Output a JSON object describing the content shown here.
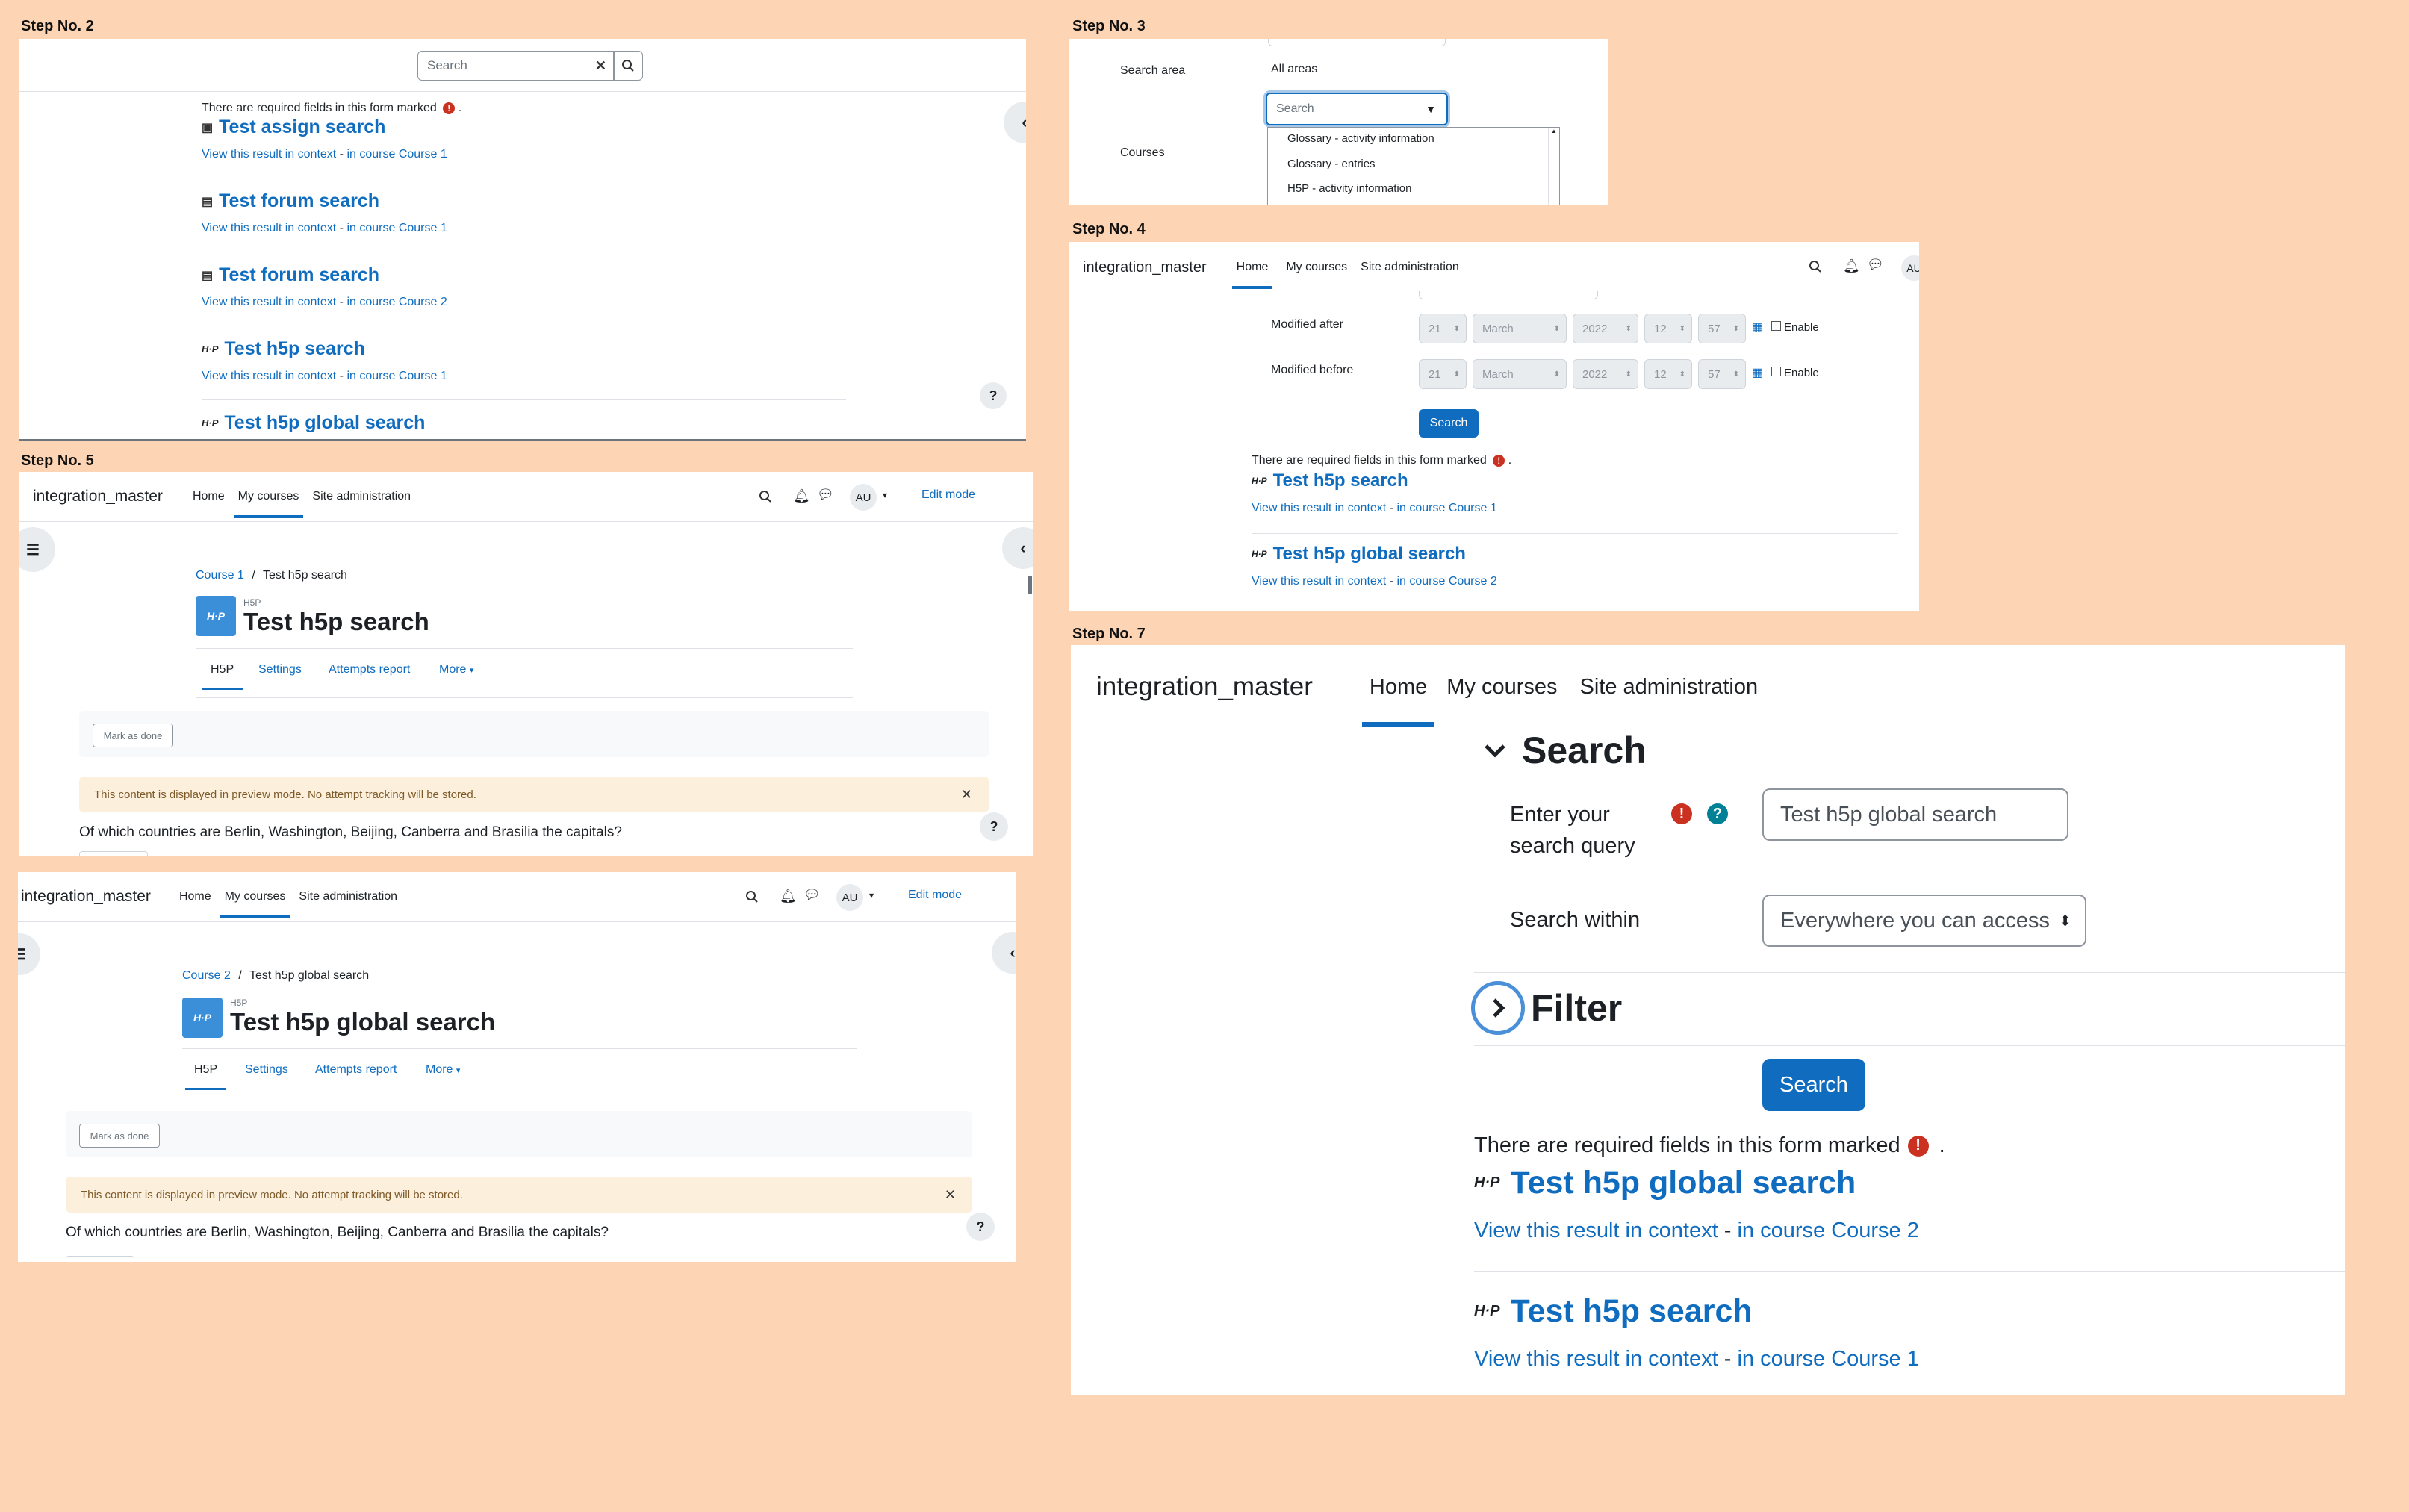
{
  "labels": {
    "step2": "Step No. 2",
    "step3": "Step No. 3",
    "step4": "Step No. 4",
    "step5": "Step No. 5",
    "step7": "Step No. 7"
  },
  "common": {
    "required_note": "There are required fields in this form marked",
    "view_context": "View this result in context",
    "dash": " - ",
    "site_name": "integration_master",
    "nav_home": "Home",
    "nav_courses": "My courses",
    "nav_admin": "Site administration",
    "avatar": "AU",
    "edit_mode": "Edit mode",
    "help": "?",
    "h5p_type": "H5P",
    "h5p_logo": "H·P",
    "tab_h5p": "H5P",
    "tab_settings": "Settings",
    "tab_attempts": "Attempts report",
    "tab_more": "More",
    "mark_done": "Mark as done",
    "preview_alert": "This content is displayed in preview mode. No attempt tracking will be stored.",
    "question": "Of which countries are Berlin, Washington, Beijing, Canberra and Brasilia the capitals?",
    "close": "✕"
  },
  "step2": {
    "search_placeholder": "Search",
    "results": [
      {
        "icon": "assign",
        "title": "Test assign search",
        "course": "in course Course 1"
      },
      {
        "icon": "forum",
        "title": "Test forum search",
        "course": "in course Course 1"
      },
      {
        "icon": "forum",
        "title": "Test forum search",
        "course": "in course Course 2"
      },
      {
        "icon": "h5p",
        "title": "Test h5p search",
        "course": "in course Course 1"
      },
      {
        "icon": "h5p",
        "title": "Test h5p global search",
        "course": ""
      }
    ]
  },
  "step3": {
    "search_area_label": "Search area",
    "all_areas": "All areas",
    "search_placeholder": "Search",
    "courses_label": "Courses",
    "options": [
      "Glossary - activity information",
      "Glossary - entries",
      "H5P - activity information"
    ]
  },
  "step4": {
    "modified_after": "Modified after",
    "modified_before": "Modified before",
    "day": "21",
    "month": "March",
    "year": "2022",
    "hour": "12",
    "minute": "57",
    "enable": "Enable",
    "search_button": "Search",
    "results": [
      {
        "title": "Test h5p search",
        "course": "in course Course 1"
      },
      {
        "title": "Test h5p global search",
        "course": "in course Course 2"
      }
    ]
  },
  "step5": {
    "breadcrumb_course": "Course 1",
    "breadcrumb_current": "Test h5p search",
    "title": "Test h5p search"
  },
  "step6": {
    "breadcrumb_course": "Course 2",
    "breadcrumb_current": "Test h5p global search",
    "title": "Test h5p global search"
  },
  "step7": {
    "section_search": "Search",
    "query_label_1": "Enter your",
    "query_label_2": "search query",
    "query_value": "Test h5p global search",
    "within_label": "Search within",
    "within_value": "Everywhere you can access",
    "section_filter": "Filter",
    "search_button": "Search",
    "results": [
      {
        "title": "Test h5p global search",
        "course": "in course Course 2"
      },
      {
        "title": "Test h5p search",
        "course": "in course Course 1"
      }
    ]
  },
  "colors": {
    "background": "#fdd5b4",
    "link": "#0f6cbf",
    "required": "#ca3120",
    "alert_bg": "#fcefdc"
  }
}
